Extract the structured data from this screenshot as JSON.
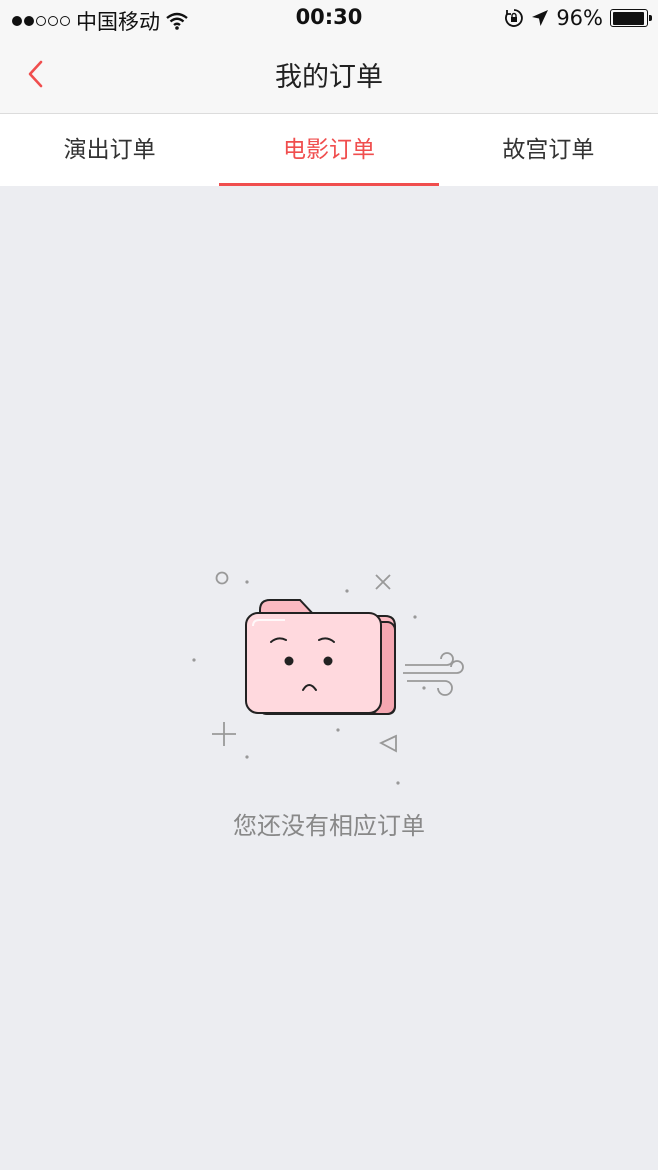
{
  "status_bar": {
    "carrier": "中国移动",
    "time": "00:30",
    "battery": "96%",
    "signal_filled": 2,
    "signal_total": 5
  },
  "nav": {
    "title": "我的订单",
    "back_icon": "chevron-left-icon"
  },
  "tabs": [
    {
      "label": "演出订单",
      "active": false
    },
    {
      "label": "电影订单",
      "active": true
    },
    {
      "label": "故宫订单",
      "active": false
    }
  ],
  "empty_state": {
    "illustration": "sad-folder-icon",
    "message": "您还没有相应订单"
  },
  "colors": {
    "accent": "#f04e4e",
    "background": "#ecedf1",
    "folder_pink": "#ffd9de"
  }
}
